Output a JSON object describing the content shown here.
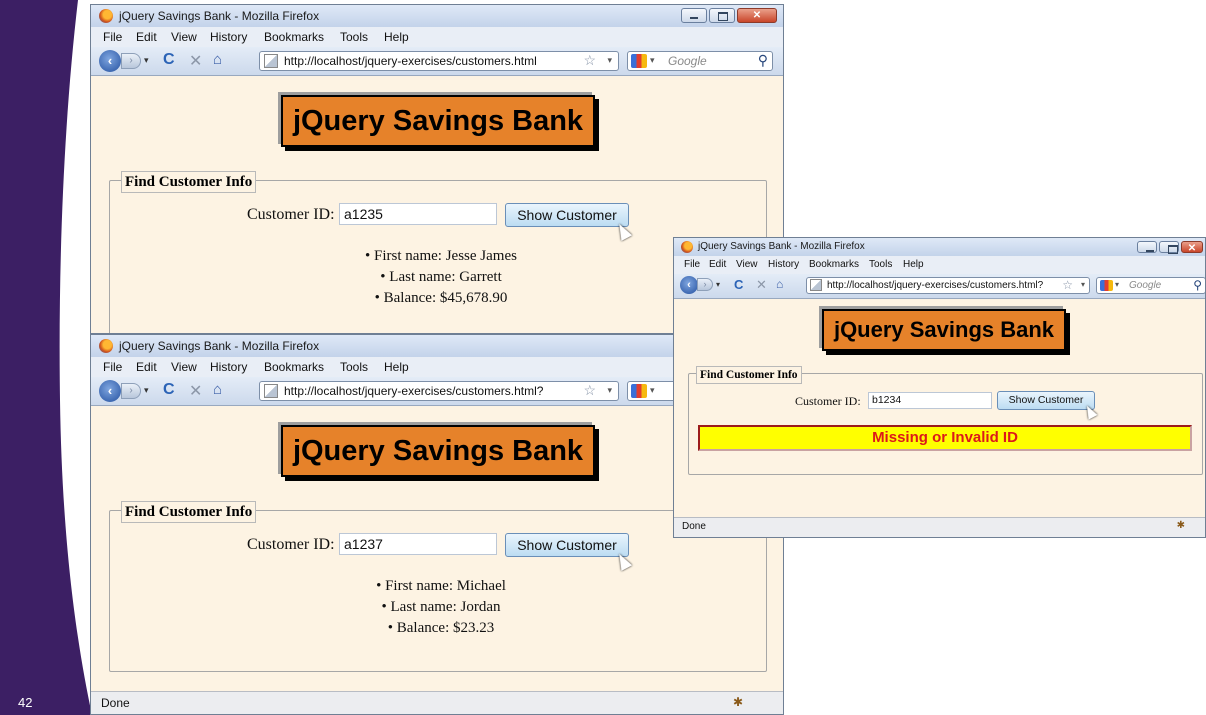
{
  "slide": {
    "page_number": "42",
    "accent_color": "#3c1f64"
  },
  "windows": {
    "top": {
      "title": "jQuery Savings Bank - Mozilla Firefox",
      "url": "http://localhost/jquery-exercises/customers.html",
      "search_placeholder": "Google",
      "banner": "jQuery Savings Bank",
      "legend": "Find Customer Info",
      "id_label": "Customer ID:",
      "id_value": "a1235",
      "button_label": "Show Customer",
      "info": [
        "First name: Jesse James",
        "Last name: Garrett",
        "Balance: $45,678.90"
      ]
    },
    "bottom": {
      "title": "jQuery Savings Bank - Mozilla Firefox",
      "url": "http://localhost/jquery-exercises/customers.html?",
      "banner": "jQuery Savings Bank",
      "legend": "Find Customer Info",
      "id_label": "Customer ID:",
      "id_value": "a1237",
      "button_label": "Show Customer",
      "info": [
        "First name: Michael",
        "Last name: Jordan",
        "Balance: $23.23"
      ],
      "status": "Done"
    },
    "right": {
      "title": "jQuery Savings Bank - Mozilla Firefox",
      "url": "http://localhost/jquery-exercises/customers.html?",
      "search_placeholder": "Google",
      "banner": "jQuery Savings Bank",
      "legend": "Find Customer Info",
      "id_label": "Customer ID:",
      "id_value": "b1234",
      "button_label": "Show Customer",
      "error": "Missing or Invalid ID",
      "status": "Done"
    }
  },
  "menu": [
    "File",
    "Edit",
    "View",
    "History",
    "Bookmarks",
    "Tools",
    "Help"
  ]
}
